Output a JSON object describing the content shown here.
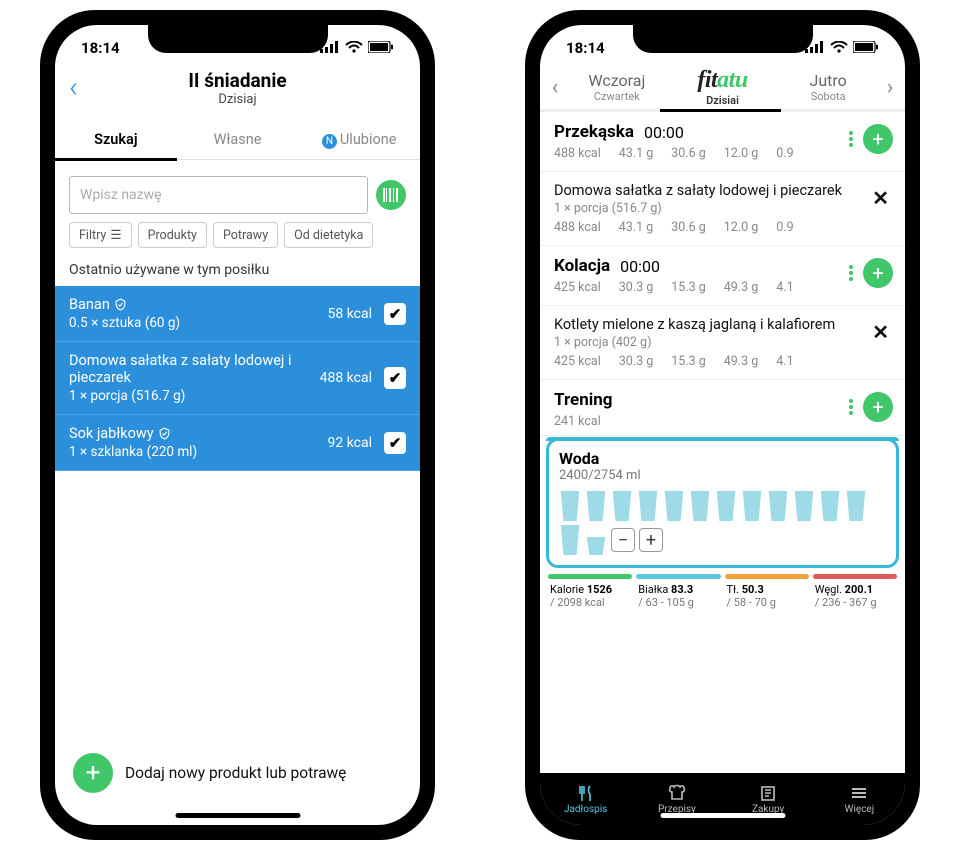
{
  "status": {
    "time": "18:14"
  },
  "phone1": {
    "title": "II śniadanie",
    "subtitle": "Dzisiaj",
    "tabs": [
      "Szukaj",
      "Własne",
      "Ulubione"
    ],
    "search_placeholder": "Wpisz nazwę",
    "filters": {
      "filtry": "Filtry",
      "produkty": "Produkty",
      "potrawy": "Potrawy",
      "diet": "Od dietetyka"
    },
    "recent_label": "Ostatnio używane w tym posiłku",
    "items": [
      {
        "name": "Banan",
        "qty": "0.5 × sztuka (60 g)",
        "kcal": "58 kcal",
        "verified": true
      },
      {
        "name": "Domowa sałatka z sałaty lodowej i pieczarek",
        "qty": "1 × porcja (516.7 g)",
        "kcal": "488 kcal",
        "verified": false
      },
      {
        "name": "Sok jabłkowy",
        "qty": "1 × szklanka (220 ml)",
        "kcal": "92 kcal",
        "verified": true
      }
    ],
    "add_label": "Dodaj nowy produkt lub potrawę"
  },
  "phone2": {
    "logo": {
      "fit": "fit",
      "atu": "atu"
    },
    "days": {
      "prev": {
        "d1": "Wczoraj",
        "d2": "Czwartek"
      },
      "today": "Dzisiai",
      "next": {
        "d1": "Jutro",
        "d2": "Sobota"
      }
    },
    "meals": [
      {
        "name": "Przekąska",
        "time": "00:00",
        "macros": [
          "488 kcal",
          "43.1 g",
          "30.6 g",
          "12.0 g",
          "0.9"
        ],
        "dish": {
          "name": "Domowa sałatka z sałaty lodowej i pieczarek",
          "qty": "1 × porcja (516.7 g)",
          "macros": [
            "488 kcal",
            "43.1 g",
            "30.6 g",
            "12.0 g",
            "0.9"
          ]
        }
      },
      {
        "name": "Kolacja",
        "time": "00:00",
        "macros": [
          "425 kcal",
          "30.3 g",
          "15.3 g",
          "49.3 g",
          "4.1"
        ],
        "dish": {
          "name": "Kotlety mielone z kaszą jaglaną i kalafiorem",
          "qty": "1 × porcja (402 g)",
          "macros": [
            "425 kcal",
            "30.3 g",
            "15.3 g",
            "49.3 g",
            "4.1"
          ]
        }
      }
    ],
    "training": {
      "name": "Trening",
      "kcal": "241 kcal"
    },
    "water": {
      "title": "Woda",
      "sub": "2400/2754 ml"
    },
    "summary": {
      "kal": {
        "l": "Kalorie",
        "v": "1526",
        "sub": "/ 2098 kcal"
      },
      "pro": {
        "l": "Białka",
        "v": "83.3",
        "sub": "/ 63 - 105 g"
      },
      "fat": {
        "l": "Tł.",
        "v": "50.3",
        "sub": "/ 58 - 70 g"
      },
      "carb": {
        "l": "Węgl.",
        "v": "200.1",
        "sub": "/ 236 - 367 g"
      }
    },
    "nav": [
      "Jadłospis",
      "Przepisy",
      "Zakupy",
      "Więcej"
    ]
  }
}
